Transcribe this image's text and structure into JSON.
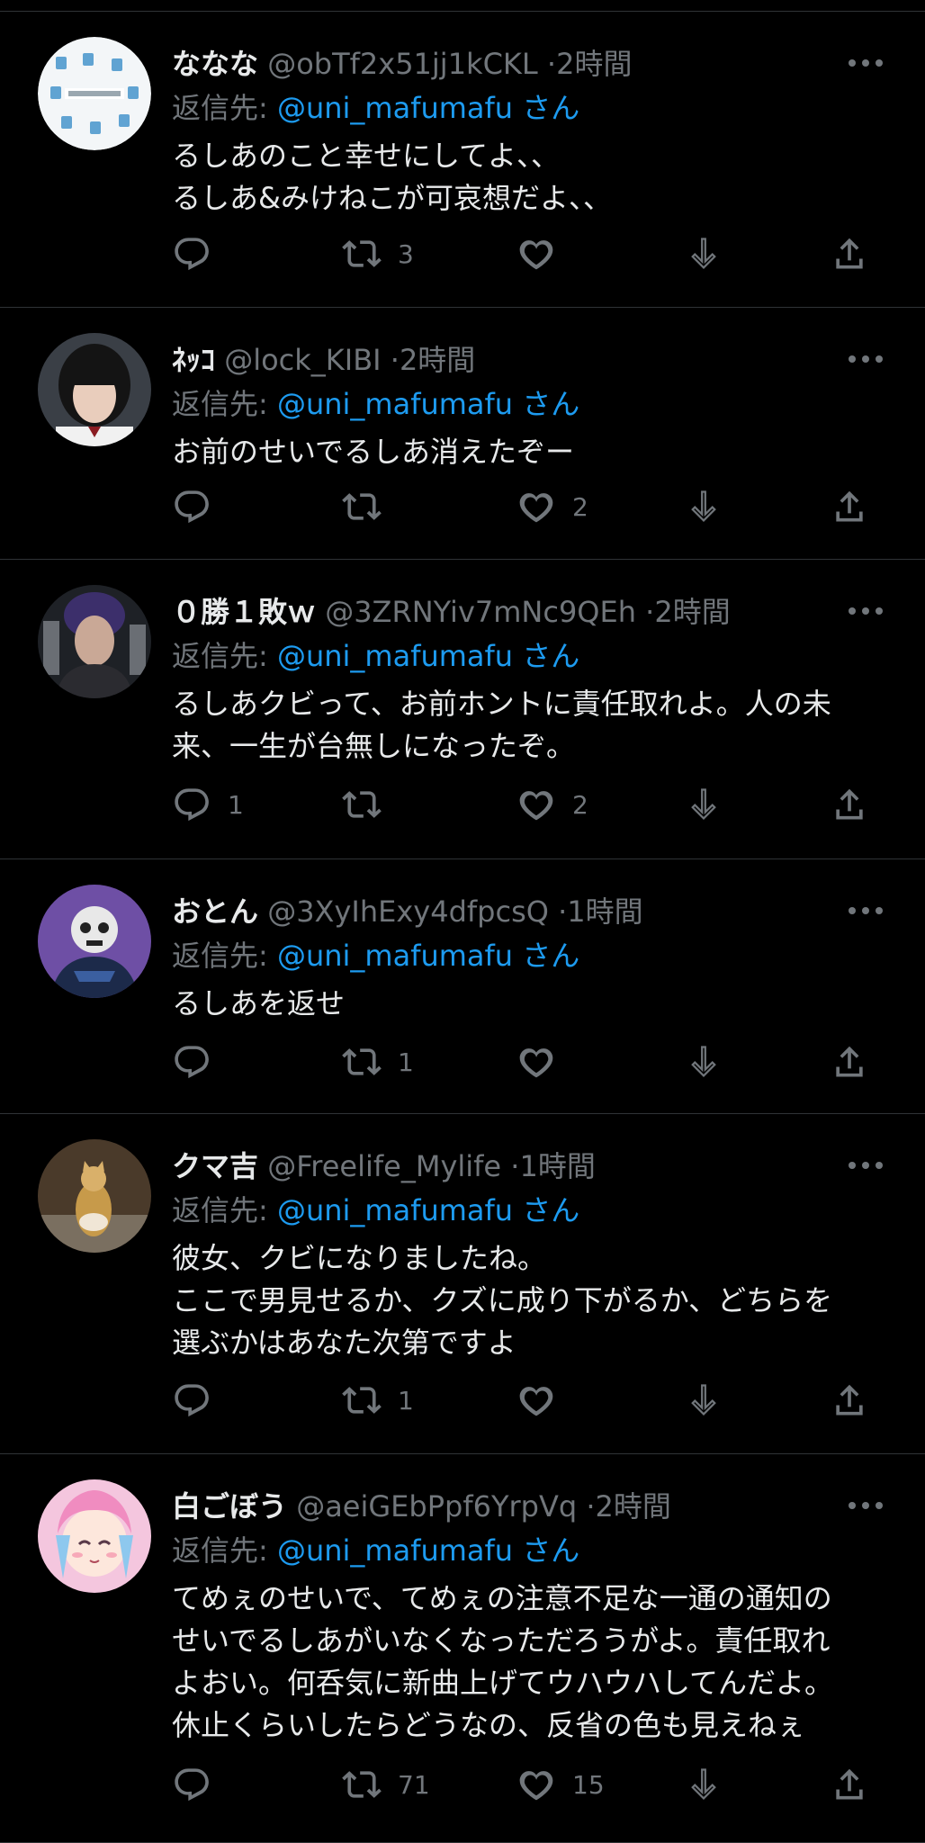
{
  "colors": {
    "background": "#000000",
    "separator": "#2f3336",
    "text_primary": "#e7e9ea",
    "text_secondary": "#71767b",
    "mention": "#1d9bf0"
  },
  "icons": {
    "reply": "speech-bubble-icon",
    "retweet": "retweet-arrows-icon",
    "like": "heart-icon",
    "download": "down-arrow-icon",
    "share": "share-upload-icon",
    "more": "three-dots-icon"
  },
  "tweets": [
    {
      "display_name": "ななな",
      "handle": "@obTf2x51jj1kCKL",
      "dot": "·",
      "time": "2時間",
      "reply_prefix": "返信先: ",
      "reply_mention": "@uni_mafumafu",
      "reply_suffix": "さん",
      "text": "るしあのこと幸せにしてよ、、\nるしあ&みけねこが可哀想だよ、、",
      "reply_count": "",
      "retweet_count": "3",
      "like_count": ""
    },
    {
      "display_name": "ﾈｯｺ",
      "handle": "@lock_KIBI",
      "dot": "·",
      "time": "2時間",
      "reply_prefix": "返信先: ",
      "reply_mention": "@uni_mafumafu",
      "reply_suffix": "さん",
      "text": "お前のせいでるしあ消えたぞー",
      "reply_count": "",
      "retweet_count": "",
      "like_count": "2"
    },
    {
      "display_name": "０勝１敗ｗ",
      "handle": "@3ZRNYiv7mNc9QEh",
      "dot": "·",
      "time": "2時間",
      "reply_prefix": "返信先: ",
      "reply_mention": "@uni_mafumafu",
      "reply_suffix": "さん",
      "text": "るしあクビって、お前ホントに責任取れよ。人の未\n来、一生が台無しになったぞ。",
      "reply_count": "1",
      "retweet_count": "",
      "like_count": "2"
    },
    {
      "display_name": "おとん",
      "handle": "@3XyIhExy4dfpcsQ",
      "dot": "·",
      "time": "1時間",
      "reply_prefix": "返信先: ",
      "reply_mention": "@uni_mafumafu",
      "reply_suffix": "さん",
      "text": "るしあを返せ",
      "reply_count": "",
      "retweet_count": "1",
      "like_count": ""
    },
    {
      "display_name": "クマ吉",
      "handle": "@Freelife_Mylife",
      "dot": "·",
      "time": "1時間",
      "reply_prefix": "返信先: ",
      "reply_mention": "@uni_mafumafu",
      "reply_suffix": "さん",
      "text": "彼女、クビになりましたね。\nここで男見せるか、クズに成り下がるか、どちらを\n選ぶかはあなた次第ですよ",
      "reply_count": "",
      "retweet_count": "1",
      "like_count": ""
    },
    {
      "display_name": "白ごぼう",
      "handle": "@aeiGEbPpf6YrpVq",
      "dot": "·",
      "time": "2時間",
      "reply_prefix": "返信先: ",
      "reply_mention": "@uni_mafumafu",
      "reply_suffix": "さん",
      "text": "てめぇのせいで、てめぇの注意不足な一通の通知の\nせいでるしあがいなくなっただろうがよ。責任取れ\nよおい。何呑気に新曲上げてウハウハしてんだよ。\n休止くらいしたらどうなの、反省の色も見えねぇ",
      "reply_count": "",
      "retweet_count": "71",
      "like_count": "15"
    }
  ]
}
